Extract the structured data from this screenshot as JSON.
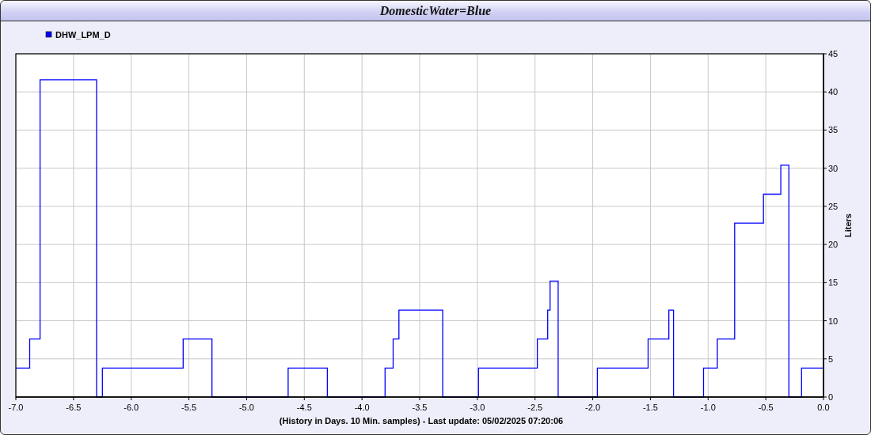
{
  "window": {
    "title": "DomesticWater=Blue"
  },
  "chart": {
    "chart_data": {
      "type": "line",
      "xlabel": "(History in Days. 10 Min. samples) - Last update: 05/02/2025 07:20:06",
      "ylabel": "Liters",
      "x": [
        -7.0,
        -6.88,
        -6.88,
        -6.79,
        -6.79,
        -6.3,
        -6.3,
        -6.25,
        -6.25,
        -5.55,
        -5.55,
        -5.3,
        -5.3,
        -4.64,
        -4.64,
        -4.3,
        -4.3,
        -3.8,
        -3.8,
        -3.73,
        -3.73,
        -3.68,
        -3.68,
        -3.3,
        -3.3,
        -2.99,
        -2.99,
        -2.48,
        -2.48,
        -2.39,
        -2.39,
        -2.37,
        -2.37,
        -2.3,
        -2.3,
        -1.96,
        -1.96,
        -1.52,
        -1.52,
        -1.34,
        -1.34,
        -1.3,
        -1.3,
        -1.04,
        -1.04,
        -0.92,
        -0.92,
        -0.77,
        -0.77,
        -0.52,
        -0.52,
        -0.37,
        -0.37,
        -0.3,
        -0.3,
        -0.19,
        -0.19,
        0.0
      ],
      "series": [
        {
          "name": "DHW_LPM_D",
          "color": "#0000ff",
          "values": [
            3.8,
            3.8,
            7.6,
            7.6,
            41.6,
            41.6,
            0,
            0,
            3.8,
            3.8,
            7.6,
            7.6,
            0,
            0,
            3.8,
            3.8,
            0,
            0,
            3.8,
            3.8,
            7.6,
            7.6,
            11.4,
            11.4,
            0,
            0,
            3.8,
            3.8,
            7.6,
            7.6,
            11.4,
            11.4,
            15.2,
            15.2,
            0,
            0,
            3.8,
            3.8,
            7.6,
            7.6,
            11.4,
            11.4,
            0,
            0,
            3.8,
            3.8,
            7.6,
            7.6,
            22.8,
            22.8,
            26.6,
            26.6,
            30.4,
            30.4,
            0,
            0,
            3.8,
            3.8
          ]
        }
      ],
      "xlim": [
        -7,
        0
      ],
      "ylim": [
        0,
        45
      ],
      "xticks": [
        {
          "value": -7,
          "label": "-7.0"
        },
        {
          "value": -6.5,
          "label": "-6.5"
        },
        {
          "value": -6,
          "label": "-6.0"
        },
        {
          "value": -5.5,
          "label": "-5.5"
        },
        {
          "value": -5,
          "label": "-5.0"
        },
        {
          "value": -4.5,
          "label": "-4.5"
        },
        {
          "value": -4,
          "label": "-4.0"
        },
        {
          "value": -3.5,
          "label": "-3.5"
        },
        {
          "value": -3,
          "label": "-3.0"
        },
        {
          "value": -2.5,
          "label": "-2.5"
        },
        {
          "value": -2,
          "label": "-2.0"
        },
        {
          "value": -1.5,
          "label": "-1.5"
        },
        {
          "value": -1,
          "label": "-1.0"
        },
        {
          "value": -0.5,
          "label": "-0.5"
        },
        {
          "value": 0,
          "label": "0.0"
        }
      ],
      "yticks": [
        0,
        5,
        10,
        15,
        20,
        25,
        30,
        35,
        40,
        45
      ],
      "grid": true
    }
  }
}
